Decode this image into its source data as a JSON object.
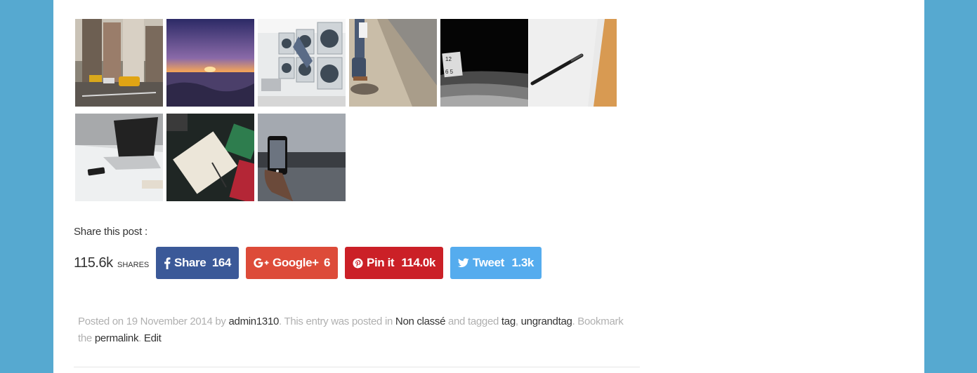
{
  "gallery": {
    "images": [
      {
        "name": "city-street-image"
      },
      {
        "name": "sunset-beach-image"
      },
      {
        "name": "laundromat-image"
      },
      {
        "name": "skateboard-image"
      },
      {
        "name": "clock-dark-image"
      },
      {
        "name": "pen-paper-image"
      },
      {
        "name": "laptop-desk-image"
      },
      {
        "name": "notebook-desk-image"
      },
      {
        "name": "phone-photo-image"
      }
    ]
  },
  "share": {
    "title": "Share this post :",
    "total_count": "115.6k",
    "total_label": "SHARES",
    "buttons": [
      {
        "id": "facebook",
        "icon": "facebook-icon",
        "label": "Share",
        "count": "164",
        "color": "#3b5998"
      },
      {
        "id": "googleplus",
        "icon": "googleplus-icon",
        "label": "Google+",
        "count": "6",
        "color": "#dd4b39"
      },
      {
        "id": "pinterest",
        "icon": "pinterest-icon",
        "label": "Pin it",
        "count": "114.0k",
        "color": "#cb2027"
      },
      {
        "id": "twitter",
        "icon": "twitter-icon",
        "label": "Tweet",
        "count": "1.3k",
        "color": "#55acee"
      }
    ]
  },
  "entry_meta": {
    "posted_on": "Posted on ",
    "date": "19 November 2014",
    "by": " by ",
    "author": "admin1310",
    "posted_in": ". This entry was posted in ",
    "category": "Non classé",
    "tagged": " and tagged ",
    "tag1": "tag",
    "comma": ", ",
    "tag2": "ungrandtag",
    "bookmark": ". Bookmark the ",
    "permalink": "permalink",
    "period": ". ",
    "edit": "Edit"
  }
}
